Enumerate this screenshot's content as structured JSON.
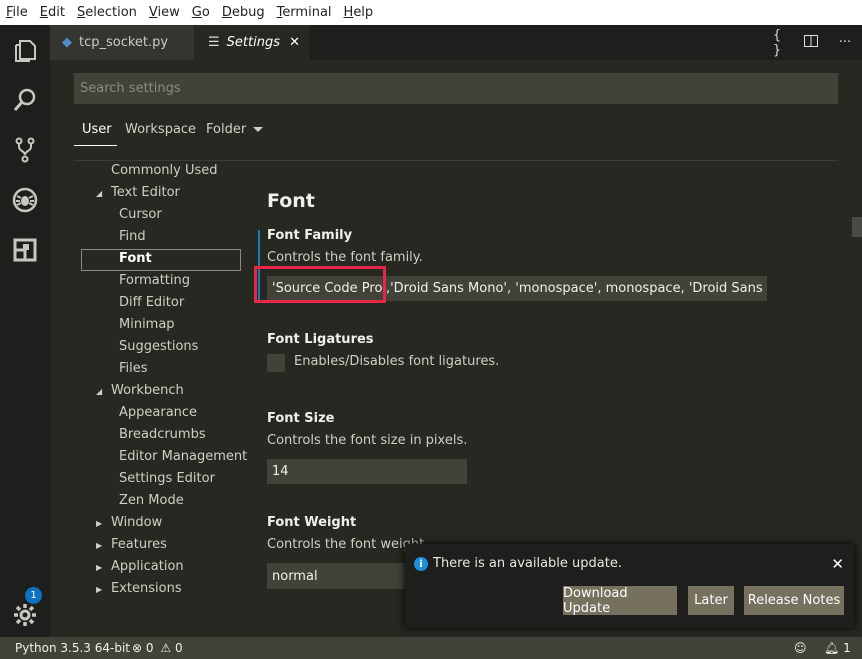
{
  "menu": [
    "File",
    "Edit",
    "Selection",
    "View",
    "Go",
    "Debug",
    "Terminal",
    "Help"
  ],
  "menu_mnemonic": [
    "F",
    "E",
    "S",
    "V",
    "G",
    "D",
    "T",
    "H"
  ],
  "activity": {
    "icons": [
      "explorer-icon",
      "search-icon",
      "source-control-icon",
      "debug-icon",
      "extensions-icon"
    ],
    "manage_icon": "gear-icon",
    "badge": "1"
  },
  "tabs": [
    {
      "label": "tcp_socket.py",
      "icon": "python-icon"
    },
    {
      "label": "Settings",
      "icon": "settings-icon",
      "close": "✕"
    }
  ],
  "tab_actions": [
    "{ }",
    "split-editor-icon",
    "more-icon"
  ],
  "search": {
    "placeholder": "Search settings"
  },
  "scopes": {
    "user": "User",
    "workspace": "Workspace",
    "folder": "Folder"
  },
  "toc": {
    "commonly_used": "Commonly Used",
    "text_editor": "Text Editor",
    "te_children": [
      "Cursor",
      "Find",
      "Font",
      "Formatting",
      "Diff Editor",
      "Minimap",
      "Suggestions",
      "Files"
    ],
    "workbench": "Workbench",
    "wb_children": [
      "Appearance",
      "Breadcrumbs",
      "Editor Management",
      "Settings Editor",
      "Zen Mode"
    ],
    "collapsed": [
      "Window",
      "Features",
      "Application",
      "Extensions"
    ],
    "selected": "Font"
  },
  "section_title": "Font",
  "settings": {
    "family": {
      "title": "Font Family",
      "desc": "Controls the font family.",
      "value": "'Source Code Pro','Droid Sans Mono', 'monospace', monospace, 'Droid Sans Fallb…"
    },
    "ligatures": {
      "title": "Font Ligatures",
      "desc": "Enables/Disables font ligatures.",
      "checked": false
    },
    "size": {
      "title": "Font Size",
      "desc": "Controls the font size in pixels.",
      "value": "14"
    },
    "weight": {
      "title": "Font Weight",
      "desc": "Controls the font weight",
      "value": "normal"
    }
  },
  "notification": {
    "message": "There is an available update.",
    "buttons": [
      "Download Update",
      "Later",
      "Release Notes"
    ],
    "close": "✕"
  },
  "status": {
    "python": "Python 3.5.3 64-bit",
    "errors": "0",
    "warnings": "0",
    "bell_count": "1"
  },
  "colors": {
    "accent": "#0e70c0",
    "highlight": "#e8264a",
    "button": "#75715e"
  }
}
